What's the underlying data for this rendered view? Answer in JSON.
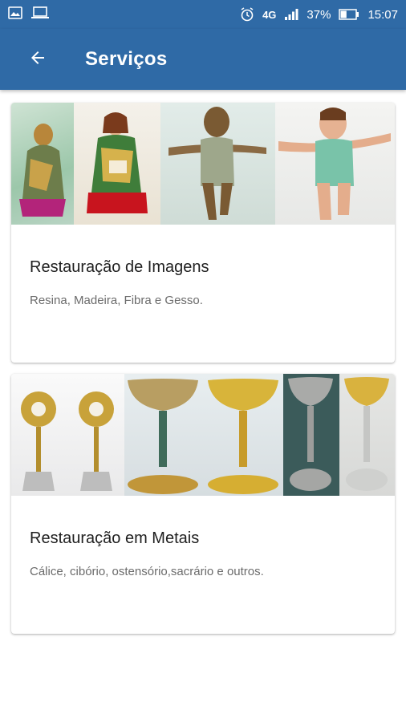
{
  "status_bar": {
    "network": "4G",
    "battery": "37%",
    "time": "15:07"
  },
  "app_bar": {
    "title": "Serviços"
  },
  "services": [
    {
      "title": "Restauração de Imagens",
      "subtitle": "Resina, Madeira, Fibra e Gesso."
    },
    {
      "title": "Restauração em Metais",
      "subtitle": "Cálice, cibório, ostensório,sacrário e outros."
    }
  ],
  "colors": {
    "primary": "#2f6aa6",
    "background": "#ffffff",
    "title_text": "#202020",
    "subtitle_text": "#6b6b6b"
  }
}
